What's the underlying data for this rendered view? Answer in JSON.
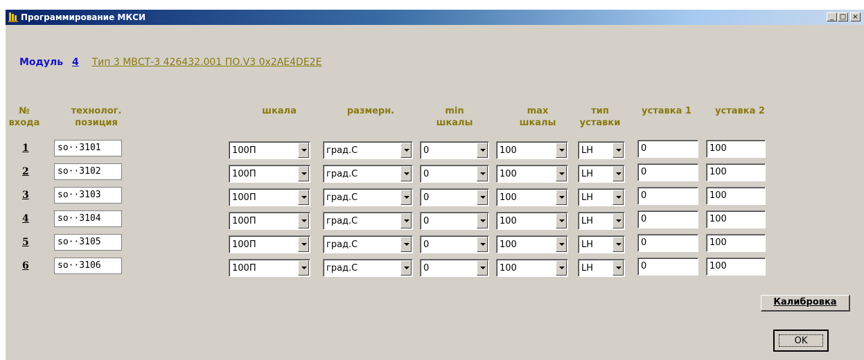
{
  "window": {
    "title": "Программирование МКСИ",
    "controls": {
      "minimize": "_",
      "maximize": "□",
      "close": "×"
    }
  },
  "module": {
    "label": "Модуль",
    "number": "4",
    "type": "Тип 3 МВСТ-3  426432.001  ПО.V3  0x2AE4DE2E"
  },
  "headers": {
    "input_no": [
      "№",
      "входа"
    ],
    "position": [
      "технолог.",
      "позиция"
    ],
    "scale": [
      "шкала"
    ],
    "units": [
      "размерн."
    ],
    "min": [
      "min",
      "шкалы"
    ],
    "max": [
      "max",
      "шкалы"
    ],
    "setpoint_type": [
      "тип",
      "уставки"
    ],
    "setpoint1": [
      "уставка 1"
    ],
    "setpoint2": [
      "уставка 2"
    ]
  },
  "rows": [
    {
      "num": "1",
      "position": "so··3101",
      "scale": "100П",
      "units": "град.С",
      "min": "0",
      "max": "100",
      "type": "LH",
      "sp1": "0",
      "sp2": "100"
    },
    {
      "num": "2",
      "position": "so··3102",
      "scale": "100П",
      "units": "град.С",
      "min": "0",
      "max": "100",
      "type": "LH",
      "sp1": "0",
      "sp2": "100"
    },
    {
      "num": "3",
      "position": "so··3103",
      "scale": "100П",
      "units": "град.С",
      "min": "0",
      "max": "100",
      "type": "LH",
      "sp1": "0",
      "sp2": "100"
    },
    {
      "num": "4",
      "position": "so··3104",
      "scale": "100П",
      "units": "град.С",
      "min": "0",
      "max": "100",
      "type": "LH",
      "sp1": "0",
      "sp2": "100"
    },
    {
      "num": "5",
      "position": "so··3105",
      "scale": "100П",
      "units": "град.С",
      "min": "0",
      "max": "100",
      "type": "LH",
      "sp1": "0",
      "sp2": "100"
    },
    {
      "num": "6",
      "position": "so··3106",
      "scale": "100П",
      "units": "град.С",
      "min": "0",
      "max": "100",
      "type": "LH",
      "sp1": "0",
      "sp2": "100"
    }
  ],
  "buttons": {
    "calibrate": "Калибровка",
    "ok": "OK"
  },
  "colors": {
    "window_bg": "#d4d0c8",
    "header_text": "#8a7a0e",
    "module_text": "#1414c8",
    "title_gradient_start": "#0a246a"
  }
}
